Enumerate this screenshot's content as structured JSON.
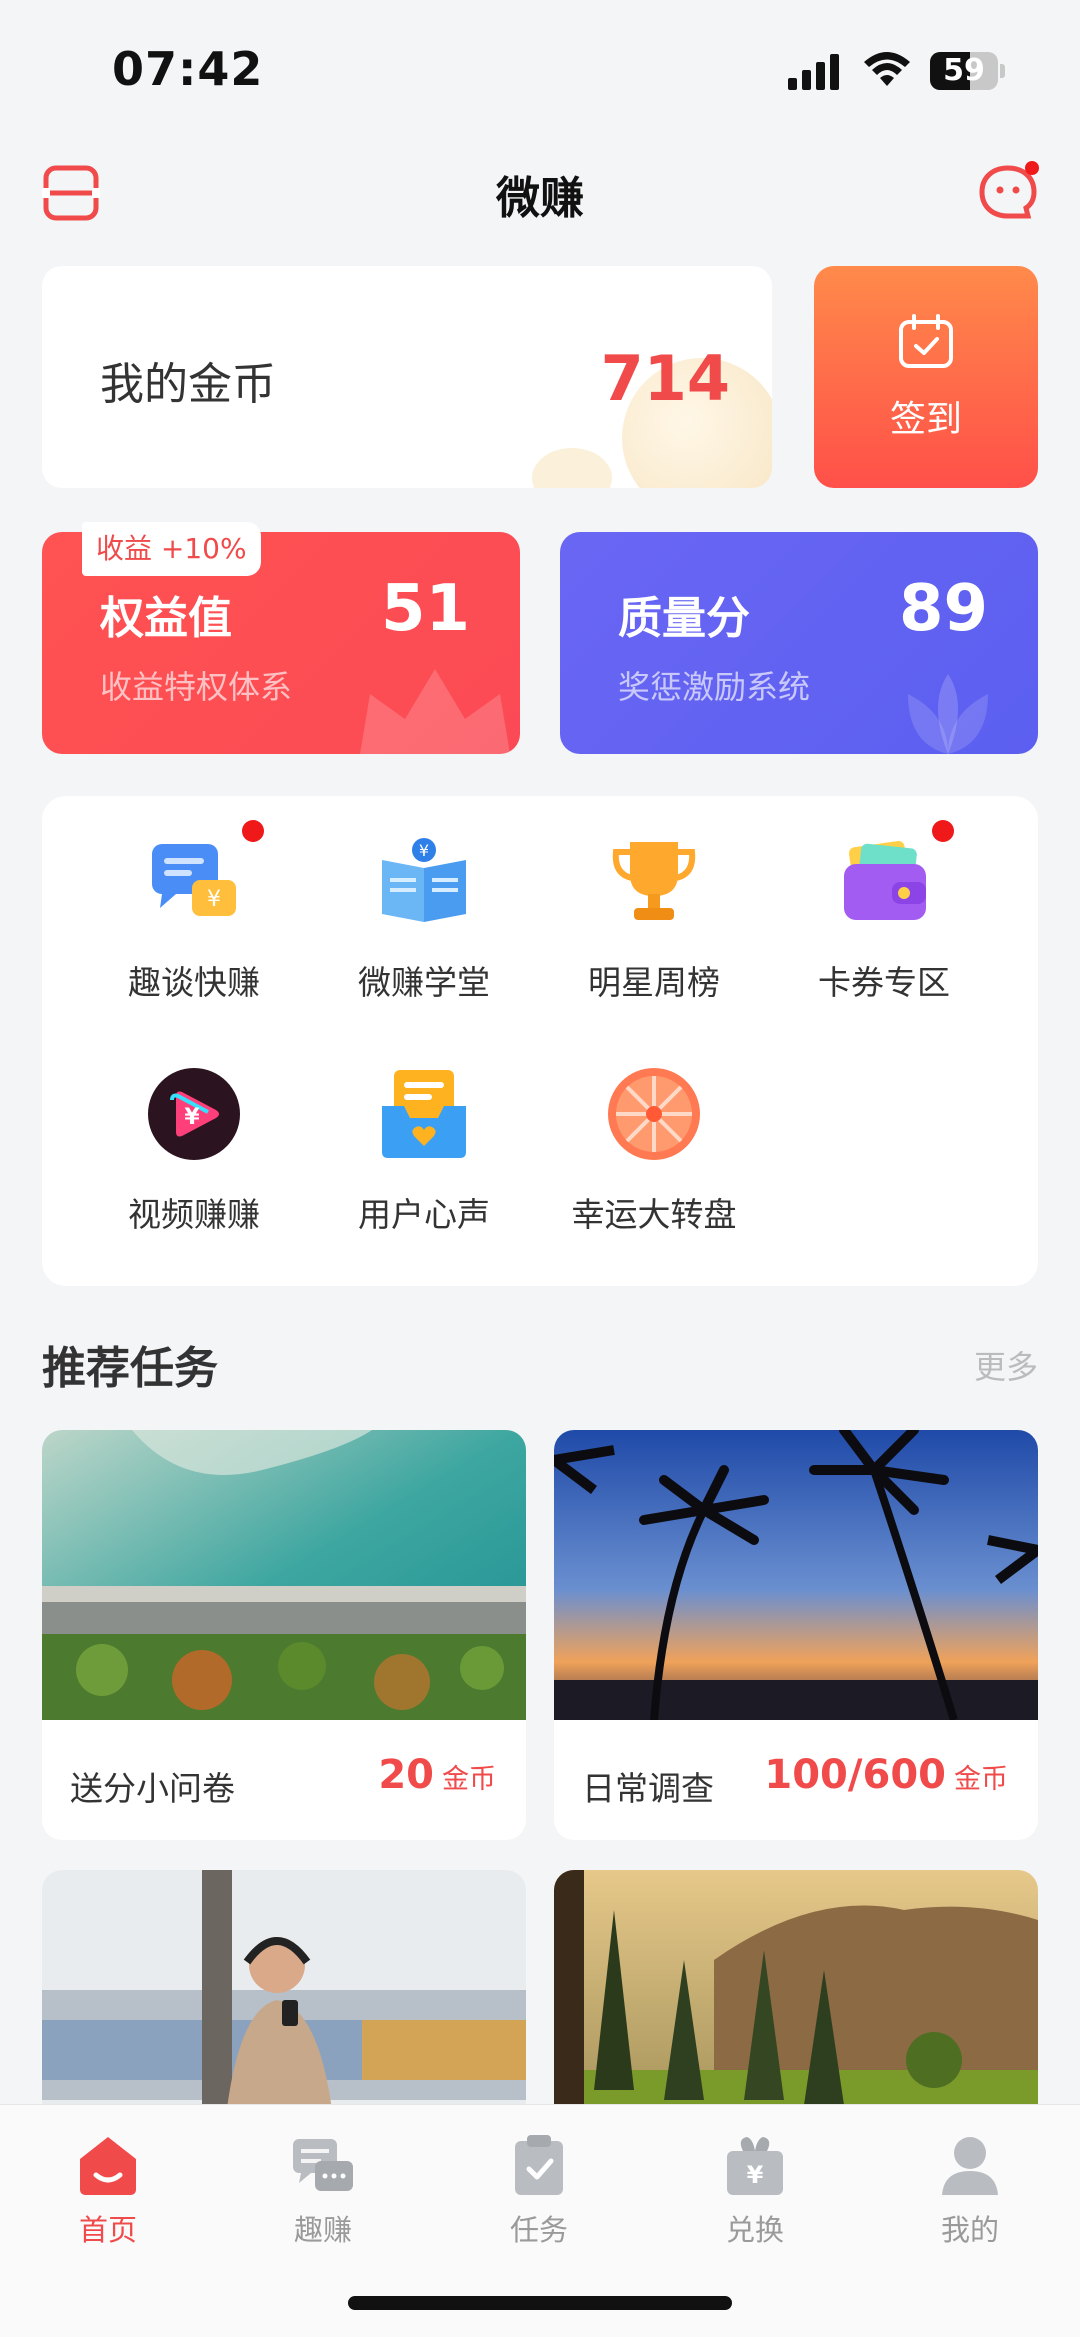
{
  "status_bar": {
    "time": "07:42",
    "battery": "59",
    "battery_level": 0.59
  },
  "nav": {
    "title": "微赚"
  },
  "coins": {
    "label": "我的金币",
    "value": "714"
  },
  "checkin": {
    "label": "签到"
  },
  "rights": {
    "tag": "收益 +10%",
    "title": "权益值",
    "value": "51",
    "subtitle": "收益特权体系"
  },
  "quality": {
    "title": "质量分",
    "value": "89",
    "subtitle": "奖惩激励系统"
  },
  "features": [
    {
      "label": "趣谈快赚",
      "icon": "chat-money-icon",
      "badge": true
    },
    {
      "label": "微赚学堂",
      "icon": "book-icon",
      "badge": false
    },
    {
      "label": "明星周榜",
      "icon": "trophy-icon",
      "badge": false
    },
    {
      "label": "卡券专区",
      "icon": "wallet-icon",
      "badge": true
    },
    {
      "label": "视频赚赚",
      "icon": "video-money-icon",
      "badge": false
    },
    {
      "label": "用户心声",
      "icon": "inbox-heart-icon",
      "badge": false
    },
    {
      "label": "幸运大转盘",
      "icon": "lucky-wheel-icon",
      "badge": false
    }
  ],
  "recommended": {
    "title": "推荐任务",
    "more": "更多",
    "tasks": [
      {
        "title": "送分小问卷",
        "reward": "20",
        "unit": "金币",
        "image": "aerial-coast-road"
      },
      {
        "title": "日常调查",
        "reward": "100/600",
        "unit": "金币",
        "image": "palm-sunset"
      },
      {
        "title": "",
        "reward": "",
        "unit": "",
        "image": "woman-phone-street"
      },
      {
        "title": "",
        "reward": "",
        "unit": "",
        "image": "forest-mountain"
      }
    ]
  },
  "tabs": [
    {
      "label": "首页",
      "icon": "home-icon",
      "active": true
    },
    {
      "label": "趣赚",
      "icon": "chat-icon",
      "active": false
    },
    {
      "label": "任务",
      "icon": "clipboard-icon",
      "active": false
    },
    {
      "label": "兑换",
      "icon": "gift-icon",
      "active": false
    },
    {
      "label": "我的",
      "icon": "user-icon",
      "active": false
    }
  ],
  "colors": {
    "accent": "#f04a4a",
    "rights": "#ff5252",
    "quality": "#6a66f4",
    "checkin": "#ff6a48"
  }
}
